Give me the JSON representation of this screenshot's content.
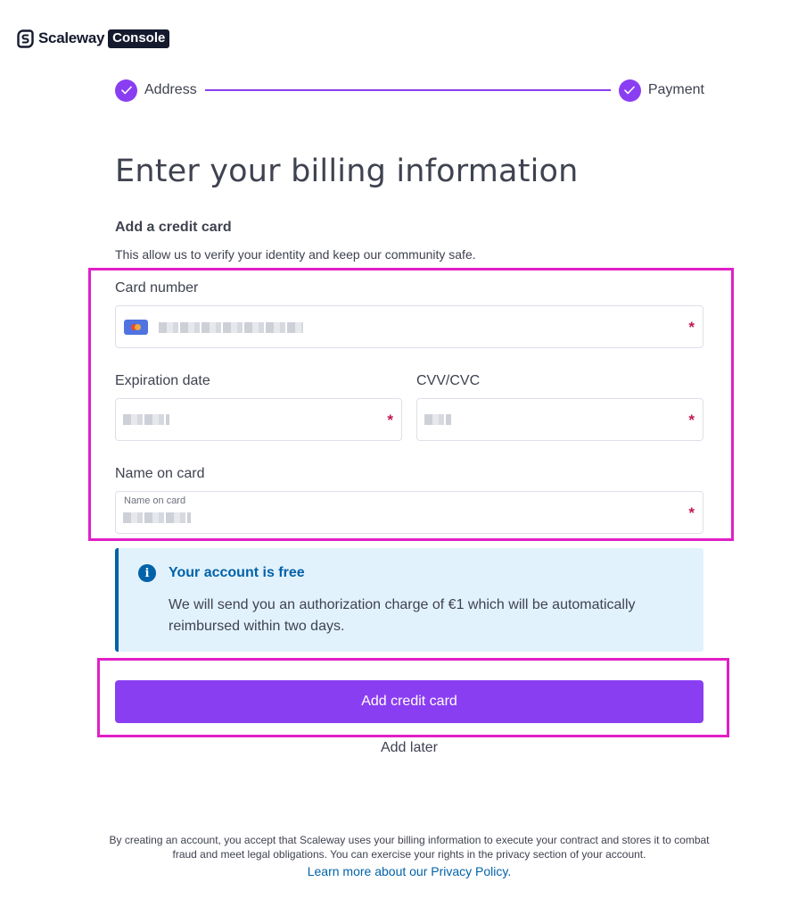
{
  "brand": {
    "name": "Scaleway",
    "badge": "Console"
  },
  "stepper": {
    "steps": [
      {
        "label": "Address",
        "status": "completed"
      },
      {
        "label": "Payment",
        "status": "completed"
      }
    ]
  },
  "page": {
    "title": "Enter your billing information",
    "section_title": "Add a credit card",
    "section_description": "This allow us to verify your identity and keep our community safe."
  },
  "form": {
    "card_number": {
      "label": "Card number",
      "value_hidden": true,
      "required_mark": "*"
    },
    "expiration_date": {
      "label": "Expiration date",
      "value_hidden": true,
      "required_mark": "*"
    },
    "cvv": {
      "label": "CVV/CVC",
      "value_hidden": true,
      "required_mark": "*"
    },
    "name_on_card": {
      "label": "Name on card",
      "floating_label": "Name on card",
      "value_hidden": true,
      "required_mark": "*"
    }
  },
  "info": {
    "icon": "info-icon",
    "title": "Your account is free",
    "text": "We will send you an authorization charge of €1 which will be automatically reimbursed within two days."
  },
  "actions": {
    "primary_label": "Add credit card",
    "secondary_label": "Add later"
  },
  "footer": {
    "text": "By creating an account, you accept that Scaleway uses your billing information to execute your contract and stores it to combat fraud and meet legal obligations. You can exercise your rights in the privacy section of your account.",
    "link_label": "Learn more about our Privacy Policy."
  },
  "colors": {
    "accent": "#8a3ef2",
    "info_bg": "#e2f2fd",
    "info_accent": "#0062a8",
    "required": "#c41852",
    "highlight_frame": "#e11fc6"
  }
}
